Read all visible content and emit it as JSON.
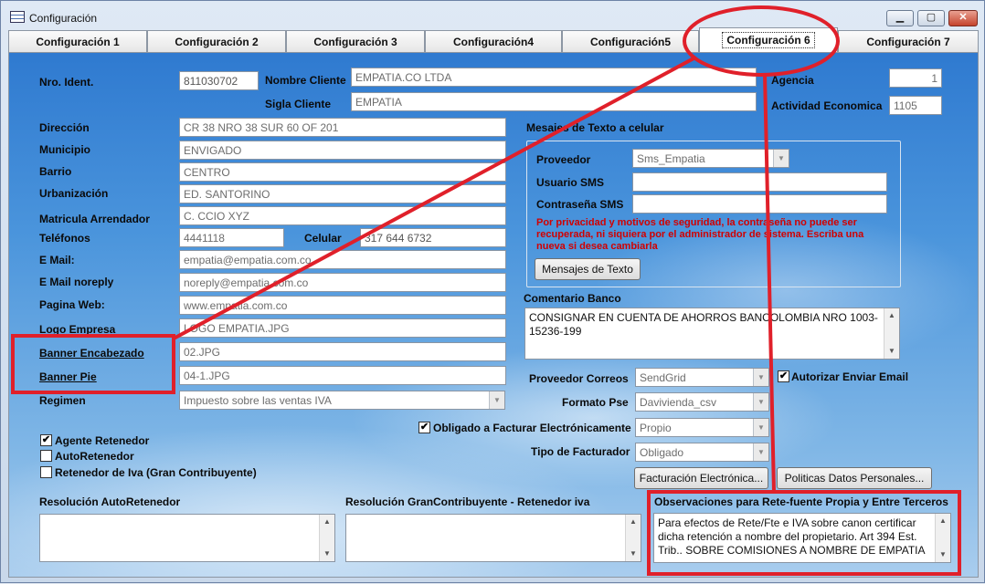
{
  "window": {
    "title": "Configuración",
    "minimize": "▁",
    "maximize": "▢",
    "close": "✕"
  },
  "tabs": [
    {
      "label": "Configuración 1"
    },
    {
      "label": "Configuración 2"
    },
    {
      "label": "Configuración 3"
    },
    {
      "label": "Configuración4"
    },
    {
      "label": "Configuración5"
    },
    {
      "label": "Configuración 6"
    },
    {
      "label": "Configuración 7"
    }
  ],
  "ident": {
    "nro_label": "Nro. Ident.",
    "nro_value": "811030702",
    "nombre_label": "Nombre Cliente",
    "nombre_value": "EMPATIA.CO LTDA",
    "sigla_label": "Sigla Cliente",
    "sigla_value": "EMPATIA",
    "agencia_label": "Agencia",
    "agencia_value": "1",
    "actividad_label": "Actividad Economica",
    "actividad_value": "1105"
  },
  "left": {
    "direccion_label": "Dirección",
    "direccion_value": "CR 38 NRO 38 SUR 60 OF 201",
    "municipio_label": "Municipio",
    "municipio_value": "ENVIGADO",
    "barrio_label": "Barrio",
    "barrio_value": "CENTRO",
    "urbanizacion_label": "Urbanización",
    "urbanizacion_value": "ED. SANTORINO",
    "matricula_label": "Matricula Arrendador",
    "matricula_value": "C. CCIO XYZ",
    "telefonos_label": "Teléfonos",
    "telefonos_value": "4441118",
    "celular_label": "Celular",
    "celular_value": "317 644 6732",
    "email_label": "E Mail:",
    "email_value": "empatia@empatia.com.co",
    "noreply_label": "E Mail noreply",
    "noreply_value": "noreply@empatia.com.co",
    "web_label": "Pagina Web:",
    "web_value": "www.empatia.com.co",
    "logo_label": "Logo Empresa",
    "logo_value": "LOGO EMPATIA.JPG",
    "banner_enc_label": "Banner Encabezado",
    "banner_enc_value": "02.JPG",
    "banner_pie_label": "Banner Pie",
    "banner_pie_value": "04-1.JPG",
    "regimen_label": "Regimen",
    "regimen_value": "Impuesto sobre las ventas IVA"
  },
  "checks": {
    "agente_label": "Agente Retenedor",
    "agente_checked": "✔",
    "autoret_label": "AutoRetenedor",
    "autoret_checked": "",
    "retiva_label": "Retenedor de Iva (Gran Contribuyente)",
    "retiva_checked": ""
  },
  "sms": {
    "group_label": "Mesajes de Texto a celular",
    "proveedor_label": "Proveedor",
    "proveedor_value": "Sms_Empatia",
    "usuario_label": "Usuario SMS",
    "usuario_value": "",
    "contrasena_label": "Contraseña SMS",
    "contrasena_value": "",
    "warning": "Por privacidad y motivos de seguridad, la contraseña no puede ser recuperada, ni siquiera por el administrador de sistema. Escriba una nueva si desea cambiarla",
    "button": "Mensajes de Texto"
  },
  "banco": {
    "label": "Comentario Banco",
    "text": "CONSIGNAR EN CUENTA DE AHORROS BANCOLOMBIA NRO 1003-15236-199"
  },
  "correo": {
    "proveedor_label": "Proveedor Correos",
    "proveedor_value": "SendGrid",
    "autorizar_label": "Autorizar Enviar Email",
    "autorizar_checked": "✔",
    "formato_label": "Formato Pse",
    "formato_value": "Davivienda_csv",
    "obligado_label": "Obligado a Facturar Electrónicamente",
    "obligado_checked": "✔",
    "obligado_value": "Propio",
    "tipo_label": "Tipo de Facturador",
    "tipo_value": "Obligado"
  },
  "buttons": {
    "facturacion": "Facturación Electrónica...",
    "politicas": "Politicas Datos Personales..."
  },
  "resoluciones": {
    "auto_label": "Resolución AutoRetenedor",
    "auto_text": "",
    "gran_label": "Resolución GranContribuyente  - Retenedor iva",
    "gran_text": "",
    "obs_label": "Observaciones para Rete-fuente Propia y Entre Terceros",
    "obs_text": "Para efectos de Rete/Fte e IVA sobre canon certificar dicha retención a nombre del propietario. Art 394 Est. Trib.. SOBRE COMISIONES A NOMBRE DE EMPATIA"
  },
  "scroll": {
    "up": "▲",
    "down": "▼"
  },
  "colors": {
    "annotation": "#e0202a",
    "warning_text": "#d10000",
    "panel_sky": "#4b95dc"
  }
}
